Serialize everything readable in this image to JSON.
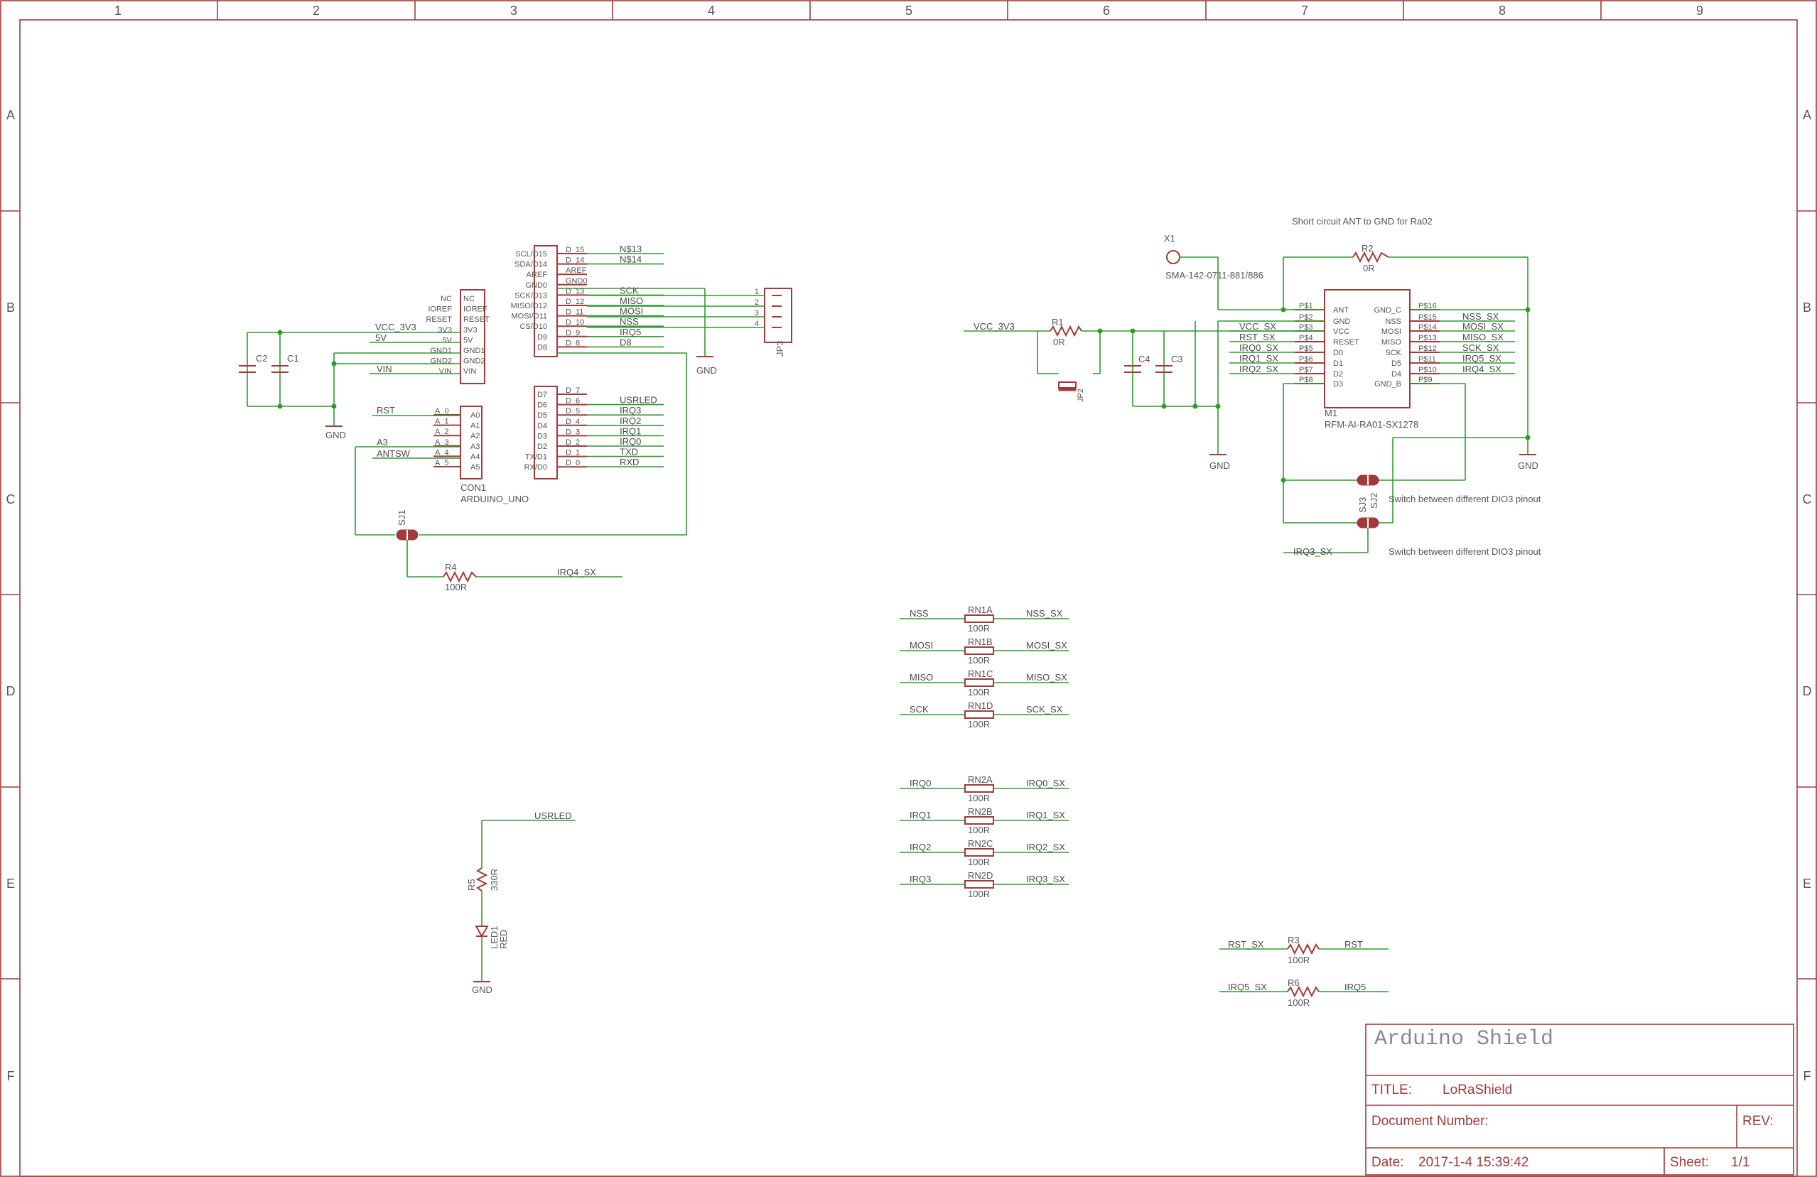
{
  "sheet": {
    "columns": [
      "1",
      "2",
      "3",
      "4",
      "5",
      "6",
      "7",
      "8",
      "9"
    ],
    "rows": [
      "A",
      "B",
      "C",
      "D",
      "E",
      "F"
    ]
  },
  "title_block": {
    "heading": "Arduino Shield",
    "title_label": "TITLE:",
    "title_value": "LoRaShield",
    "docnum_label": "Document Number:",
    "rev_label": "REV:",
    "date_label": "Date:",
    "date_value": "2017-1-4 15:39:42",
    "sheet_label": "Sheet:",
    "sheet_value": "1/1"
  },
  "notes": {
    "short_ant": "Short circuit ANT to GND for Ra02",
    "switch1": "Switch between different DIO3 pinout",
    "switch2": "Switch between different DIO3 pinout"
  },
  "arduino": {
    "ref": "CON1",
    "value": "ARDUINO_UNO",
    "power_pins": [
      "NC",
      "IOREF",
      "RESET",
      "3V3",
      "5V",
      "GND1",
      "GND2",
      "VIN"
    ],
    "power_inner": [
      "NC",
      "IOREF",
      "RESET",
      "3V3",
      "5V",
      "GND1",
      "GND2",
      "VIN"
    ],
    "analog_inner": [
      "A0",
      "A1",
      "A2",
      "A3",
      "A4",
      "A5"
    ],
    "analog_pins": [
      "A_0",
      "A_1",
      "A_2",
      "A_3",
      "A_4",
      "A_5"
    ],
    "upper_inner": [
      "SCL/D15",
      "SDA/D14",
      "AREF",
      "GND0",
      "SCK/D13",
      "MISO/D12",
      "MOSI/D11",
      "CS/D10",
      "D9",
      "D8"
    ],
    "upper_pins": [
      "D_15",
      "D_14",
      "AREF",
      "GND0",
      "D_13",
      "D_12",
      "D_11",
      "D_10",
      "D_9",
      "D_8"
    ],
    "lower_inner": [
      "D7",
      "D6",
      "D5",
      "D4",
      "D3",
      "D2",
      "TX/D1",
      "RX/D0"
    ],
    "lower_pins": [
      "D_7",
      "D_6",
      "D_5",
      "D_4",
      "D_3",
      "D_2",
      "D_1",
      "D_0"
    ]
  },
  "nets": {
    "vcc_3v3": "VCC_3V3",
    "five_v": "5V",
    "vin": "VIN",
    "rst": "RST",
    "a3": "A3",
    "antsw": "ANTSW",
    "upper": [
      "N$13",
      "N$14",
      "",
      "",
      "SCK",
      "MISO",
      "MOSI",
      "NSS",
      "IRQ5",
      "D8"
    ],
    "lower": [
      "",
      "USRLED",
      "IRQ3",
      "IRQ2",
      "IRQ1",
      "IRQ0",
      "TXD",
      "RXD"
    ],
    "gnd": "GND",
    "irq4_sx": "IRQ4_SX",
    "usrled": "USRLED",
    "vcc_3v3_right": "VCC_3V3"
  },
  "jp3": {
    "ref": "JP3",
    "pins": [
      "1",
      "2",
      "3",
      "4"
    ]
  },
  "caps": {
    "c1": "C1",
    "c2": "C2",
    "c3": "C3",
    "c4": "C4"
  },
  "resistors": {
    "r1_ref": "R1",
    "r1_val": "0R",
    "r2_ref": "R2",
    "r2_val": "0R",
    "r3_ref": "R3",
    "r3_val": "100R",
    "r4_ref": "R4",
    "r4_val": "100R",
    "r5_ref": "R5",
    "r5_val": "330R",
    "r6_ref": "R6",
    "r6_val": "100R"
  },
  "jumpers": {
    "sj1": "SJ1",
    "sj2": "SJ2",
    "sj3": "SJ3",
    "jp2": "JP2"
  },
  "led": {
    "ref": "LED1",
    "value": "RED"
  },
  "antenna": {
    "ref": "X1",
    "value": "SMA-142-0711-881/886"
  },
  "module": {
    "ref": "M1",
    "value": "RFM-AI-RA01-SX1278",
    "left_pins": [
      "P$1",
      "P$2",
      "P$3",
      "P$4",
      "P$5",
      "P$6",
      "P$7",
      "P$8"
    ],
    "left_inner": [
      "ANT",
      "GND",
      "VCC",
      "RESET",
      "D0",
      "D1",
      "D2",
      "D3"
    ],
    "left_nets": [
      "",
      "",
      "VCC_SX",
      "RST_SX",
      "IRQ0_SX",
      "IRQ1_SX",
      "IRQ2_SX",
      ""
    ],
    "right_pins": [
      "P$16",
      "P$15",
      "P$14",
      "P$13",
      "P$12",
      "P$11",
      "P$10",
      "P$9"
    ],
    "right_inner": [
      "GND_C",
      "NSS",
      "MOSI",
      "MISO",
      "SCK",
      "D5",
      "D4",
      "GND_B"
    ],
    "right_nets": [
      "",
      "NSS_SX",
      "MOSI_SX",
      "MISO_SX",
      "SCK_SX",
      "IRQ5_SX",
      "IRQ4_SX",
      ""
    ],
    "irq3_sx": "IRQ3_SX"
  },
  "rn_spi": [
    {
      "left": "NSS",
      "ref": "RN1A",
      "val": "100R",
      "right": "NSS_SX"
    },
    {
      "left": "MOSI",
      "ref": "RN1B",
      "val": "100R",
      "right": "MOSI_SX"
    },
    {
      "left": "MISO",
      "ref": "RN1C",
      "val": "100R",
      "right": "MISO_SX"
    },
    {
      "left": "SCK",
      "ref": "RN1D",
      "val": "100R",
      "right": "SCK_SX"
    }
  ],
  "rn_irq": [
    {
      "left": "IRQ0",
      "ref": "RN2A",
      "val": "100R",
      "right": "IRQ0_SX"
    },
    {
      "left": "IRQ1",
      "ref": "RN2B",
      "val": "100R",
      "right": "IRQ1_SX"
    },
    {
      "left": "IRQ2",
      "ref": "RN2C",
      "val": "100R",
      "right": "IRQ2_SX"
    },
    {
      "left": "IRQ3",
      "ref": "RN2D",
      "val": "100R",
      "right": "IRQ3_SX"
    }
  ],
  "misc_r": {
    "r3_left": "RST_SX",
    "r3_right": "RST",
    "r6_left": "IRQ5_SX",
    "r6_right": "IRQ5"
  }
}
